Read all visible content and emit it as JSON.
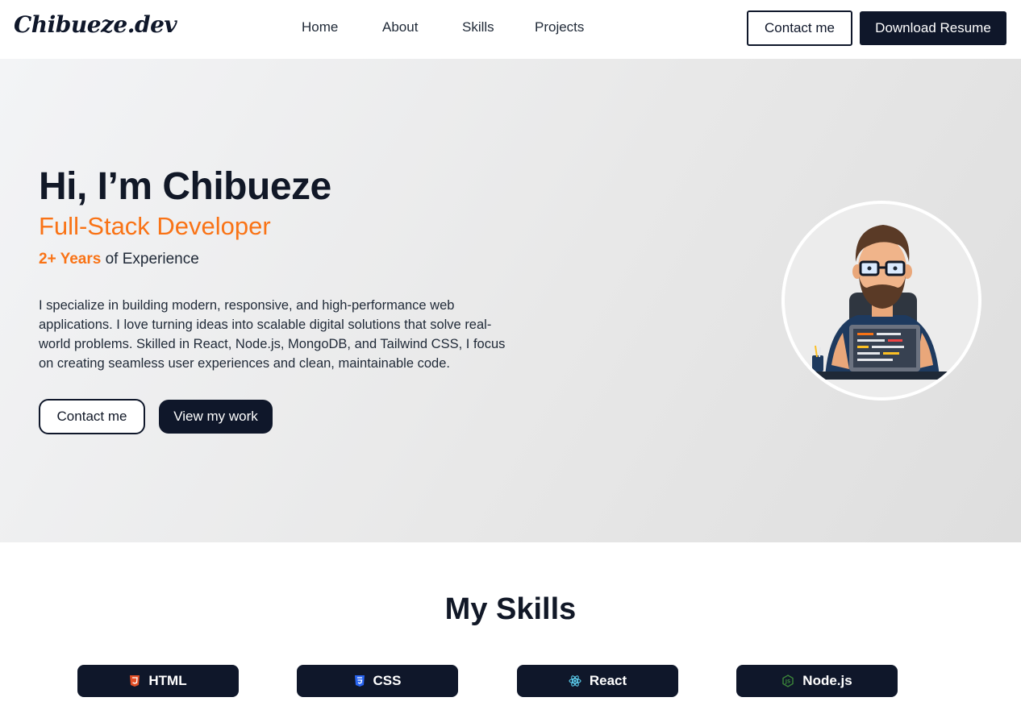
{
  "nav": {
    "logo": "Chibueze.dev",
    "links": [
      "Home",
      "About",
      "Skills",
      "Projects"
    ],
    "contact_label": "Contact me",
    "resume_label": "Download Resume"
  },
  "hero": {
    "greeting": "Hi, I’m Chibueze",
    "role": "Full-Stack Developer",
    "experience_highlight": "2+ Years",
    "experience_rest": " of Experience",
    "description": "I specialize in building modern, responsive, and high-performance web applications. I love turning ideas into scalable digital solutions that solve real-world problems. Skilled in React, Node.js, MongoDB, and Tailwind CSS, I focus on creating seamless user experiences and clean, maintainable code.",
    "contact_label": "Contact me",
    "work_label": "View my work",
    "avatar_icon": "developer-avatar-illustration"
  },
  "skills": {
    "title": "My Skills",
    "items": [
      {
        "label": "HTML",
        "icon": "html5-icon",
        "color": "#e34f26"
      },
      {
        "label": "CSS",
        "icon": "css3-icon",
        "color": "#2965f1"
      },
      {
        "label": "React",
        "icon": "react-icon",
        "color": "#61dafb"
      },
      {
        "label": "Node.js",
        "icon": "nodejs-icon",
        "color": "#3c873a"
      }
    ]
  },
  "colors": {
    "accent": "#f97316",
    "dark": "#0f172a"
  }
}
